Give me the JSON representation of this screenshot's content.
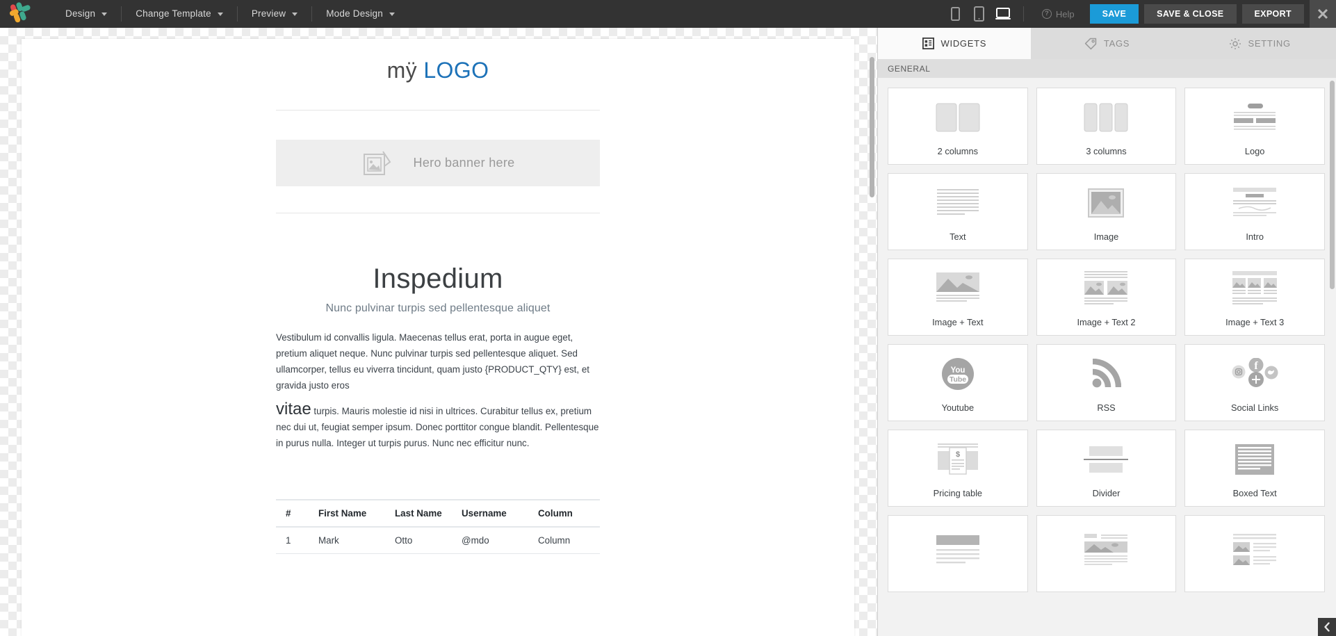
{
  "toolbar": {
    "brand_icon": "inspedium-x-logo",
    "menus": [
      {
        "label": "Design",
        "icon": "chevron-down-icon"
      },
      {
        "label": "Change Template",
        "icon": "chevron-down-icon"
      },
      {
        "label": "Preview",
        "icon": "chevron-down-icon"
      },
      {
        "label": "Mode Design",
        "icon": "chevron-down-icon"
      }
    ],
    "devices": [
      {
        "name": "mobile-view-icon",
        "active": false
      },
      {
        "name": "tablet-view-icon",
        "active": false
      },
      {
        "name": "desktop-view-icon",
        "active": true
      }
    ],
    "help_label": "Help",
    "help_icon": "question-circle-icon",
    "save_label": "SAVE",
    "save_close_label": "SAVE & CLOSE",
    "export_label": "EXPORT",
    "close_icon": "close-icon",
    "accent_color": "#1b9bd8",
    "bar_color": "#333333",
    "button_grey": "#4a4a4a"
  },
  "panel": {
    "tabs": [
      {
        "label": "WIDGETS",
        "icon": "widgets-grid-icon",
        "active": true
      },
      {
        "label": "TAGS",
        "icon": "tag-icon",
        "active": false
      },
      {
        "label": "SETTING",
        "icon": "gear-icon",
        "active": false
      }
    ],
    "section_title": "GENERAL",
    "widgets": [
      {
        "label": "2 columns",
        "icon": "two-columns-icon"
      },
      {
        "label": "3 columns",
        "icon": "three-columns-icon"
      },
      {
        "label": "Logo",
        "icon": "logo-block-icon"
      },
      {
        "label": "Text",
        "icon": "text-lines-icon"
      },
      {
        "label": "Image",
        "icon": "image-icon"
      },
      {
        "label": "Intro",
        "icon": "intro-block-icon"
      },
      {
        "label": "Image + Text",
        "icon": "image-text-icon"
      },
      {
        "label": "Image + Text 2",
        "icon": "image-text-2-icon"
      },
      {
        "label": "Image + Text 3",
        "icon": "image-text-3-icon"
      },
      {
        "label": "Youtube",
        "icon": "youtube-icon"
      },
      {
        "label": "RSS",
        "icon": "rss-icon"
      },
      {
        "label": "Social Links",
        "icon": "social-links-icon"
      },
      {
        "label": "Pricing table",
        "icon": "pricing-table-icon"
      },
      {
        "label": "Divider",
        "icon": "divider-icon"
      },
      {
        "label": "Boxed Text",
        "icon": "boxed-text-icon"
      },
      {
        "label": "",
        "icon": "heading-text-icon"
      },
      {
        "label": "",
        "icon": "image-caption-icon"
      },
      {
        "label": "",
        "icon": "image-list-icon"
      }
    ],
    "collapse_icon": "chevron-left-icon"
  },
  "document": {
    "logo_part1": "mÿ ",
    "logo_part2": "LOGO",
    "hero_label": "Hero banner here",
    "hero_icon": "image-placeholder-icon",
    "title": "Inspedium",
    "subtitle": "Nunc pulvinar turpis sed pellentesque aliquet",
    "paragraph1": "Vestibulum id convallis ligula. Maecenas tellus erat, porta in augue eget, pretium aliquet neque. Nunc pulvinar turpis sed pellentesque aliquet. Sed ullamcorper, tellus eu viverra tincidunt, quam justo {PRODUCT_QTY} est, et gravida justo eros",
    "paragraph2_lead": "vitae",
    "paragraph2": " turpis. Mauris molestie id nisi in ultrices. Curabitur tellus ex, pretium nec dui ut, feugiat semper ipsum. Donec porttitor congue blandit. Pellentesque in purus nulla. Integer ut turpis purus. Nunc nec efficitur nunc.",
    "table": {
      "headers": [
        "#",
        "First Name",
        "Last Name",
        "Username",
        "Column"
      ],
      "rows": [
        [
          "1",
          "Mark",
          "Otto",
          "@mdo",
          "Column"
        ]
      ]
    }
  }
}
